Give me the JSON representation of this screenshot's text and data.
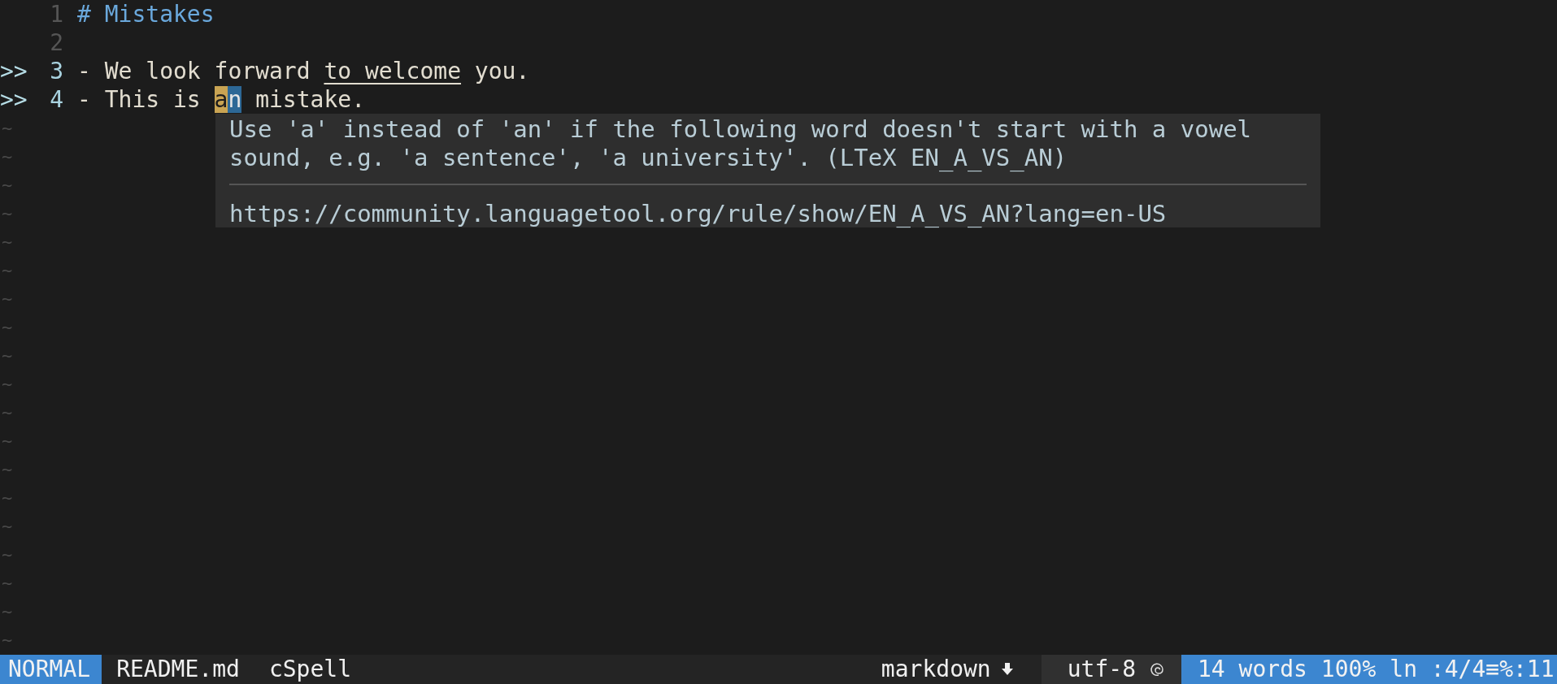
{
  "lines": [
    {
      "number": "1",
      "segments": [
        {
          "text": "# Mistakes",
          "kind": "heading"
        }
      ]
    },
    {
      "number": "2"
    },
    {
      "number": "3",
      "sign": ">>",
      "segments": [
        {
          "text": "- We look forward ",
          "kind": "plain"
        },
        {
          "text": "to welcome",
          "kind": "underline"
        },
        {
          "text": " you.",
          "kind": "plain"
        }
      ]
    },
    {
      "number": "4",
      "sign": ">>",
      "segments": [
        {
          "text": "- This is ",
          "kind": "plain"
        },
        {
          "text": "a",
          "kind": "highlight"
        },
        {
          "text": "n",
          "kind": "cursor"
        },
        {
          "text": " mistake.",
          "kind": "plain"
        }
      ]
    }
  ],
  "filler_rows": [
    "~",
    "~",
    "~",
    "~",
    "~",
    "~",
    "~",
    "~",
    "~",
    "~",
    "~",
    "~",
    "~",
    "~",
    "~",
    "~",
    "~",
    "~",
    "~"
  ],
  "popup": {
    "message": "Use 'a' instead of 'an' if the following word doesn't start with a vowel sound, e.g. 'a sentence', 'a university'. (LTeX EN_A_VS_AN)",
    "link": "https://community.languagetool.org/rule/show/EN_A_VS_AN?lang=en-US"
  },
  "status_bar": {
    "mode": "NORMAL",
    "file": "README.md",
    "checker": "cSpell",
    "filetype": "markdown",
    "encoding": "utf-8",
    "words": "14 words",
    "percent": "100%",
    "position": "ln :4/4≡%:11"
  }
}
